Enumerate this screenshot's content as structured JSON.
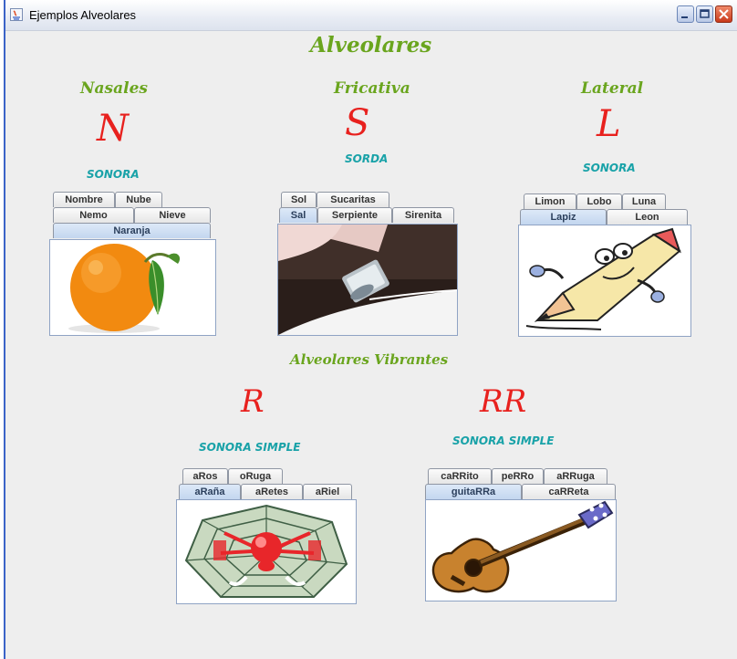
{
  "window": {
    "title": "Ejemplos Alveolares"
  },
  "headings": {
    "main": "Alveolares",
    "vibrantes": "Alveolares Vibrantes"
  },
  "nasales": {
    "category": "Nasales",
    "letter": "N",
    "voicing": "SONORA",
    "tabs_row1": [
      "Nombre",
      "Nube"
    ],
    "tabs_row2": [
      "Nemo",
      "Nieve"
    ],
    "tabs_row3": [
      "Naranja"
    ],
    "selected_tab": "Naranja",
    "image": "orange"
  },
  "fricativa": {
    "category": "Fricativa",
    "letter": "S",
    "voicing": "SORDA",
    "tabs_row1": [
      "Sol",
      "Sucaritas"
    ],
    "tabs_row2": [
      "Sal",
      "Serpiente",
      "Sirenita"
    ],
    "selected_tab": "Sal",
    "image": "salt-shaker"
  },
  "lateral": {
    "category": "Lateral",
    "letter": "L",
    "voicing": "SONORA",
    "tabs_row1": [
      "Limon",
      "Lobo",
      "Luna"
    ],
    "tabs_row2": [
      "Lapiz",
      "Leon"
    ],
    "selected_tab": "Lapiz",
    "image": "pencil-cartoon"
  },
  "r_simple": {
    "letter": "R",
    "voicing": "SONORA SIMPLE",
    "tabs_row1": [
      "aRos",
      "oRuga"
    ],
    "tabs_row2": [
      "aRaña",
      "aRetes",
      "aRiel"
    ],
    "selected_tab": "aRaña",
    "image": "spider-web"
  },
  "rr": {
    "letter": "RR",
    "voicing": "SONORA SIMPLE",
    "tabs_row1": [
      "caRRito",
      "peRRo",
      "aRRuga"
    ],
    "tabs_row2": [
      "guitaRRa",
      "caRReta"
    ],
    "selected_tab": "guitaRRa",
    "image": "guitar"
  },
  "colors": {
    "heading": "#6aa51e",
    "letter": "#e8211e",
    "voicing": "#19a2a8",
    "selected_tab": "#c3d6ef"
  }
}
